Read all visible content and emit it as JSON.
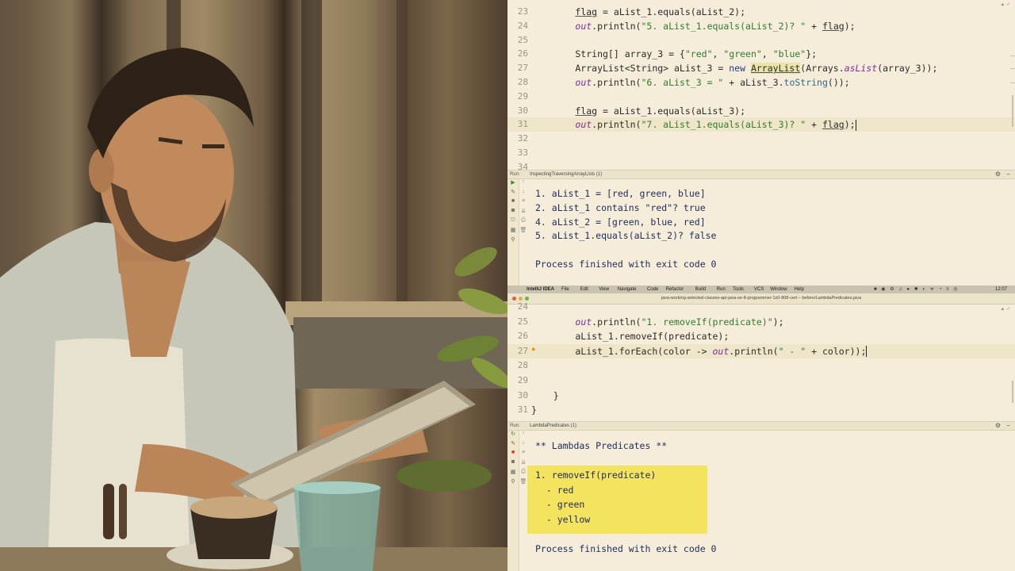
{
  "editor1": {
    "lines": [
      {
        "num": "23",
        "segments": [
          [
            "",
            "        "
          ],
          [
            "fld-u",
            "flag"
          ],
          [
            "",
            " = aList_1.equals(aList_2);"
          ]
        ]
      },
      {
        "num": "24",
        "segments": [
          [
            "",
            "        "
          ],
          [
            "fld",
            "out"
          ],
          [
            "",
            ".println("
          ],
          [
            "str",
            "\"5. aList_1.equals(aList_2)? \""
          ],
          [
            "",
            " + "
          ],
          [
            "u",
            "flag"
          ],
          [
            "",
            ");"
          ]
        ]
      },
      {
        "num": "25",
        "segments": []
      },
      {
        "num": "26",
        "segments": [
          [
            "",
            "        String[] array_3 = {"
          ],
          [
            "str",
            "\"red\""
          ],
          [
            "",
            ", "
          ],
          [
            "str",
            "\"green\""
          ],
          [
            "",
            ", "
          ],
          [
            "str",
            "\"blue\""
          ],
          [
            "",
            "};"
          ]
        ]
      },
      {
        "num": "27",
        "segments": [
          [
            "",
            "        ArrayList<String> aList_3 = "
          ],
          [
            "kw",
            "new "
          ],
          [
            "hl",
            "ArrayList"
          ],
          [
            "",
            "(Arrays."
          ],
          [
            "fld",
            "asList"
          ],
          [
            "",
            "(array_3));"
          ]
        ]
      },
      {
        "num": "28",
        "segments": [
          [
            "",
            "        "
          ],
          [
            "fld",
            "out"
          ],
          [
            "",
            ".println("
          ],
          [
            "str",
            "\"6. aList_3 = \""
          ],
          [
            "",
            " + aList_3."
          ],
          [
            "mth",
            "toString"
          ],
          [
            "",
            "());"
          ]
        ]
      },
      {
        "num": "29",
        "segments": []
      },
      {
        "num": "30",
        "segments": [
          [
            "",
            "        "
          ],
          [
            "u",
            "flag"
          ],
          [
            "",
            " = aList_1.equals(aList_3);"
          ]
        ]
      },
      {
        "num": "31",
        "segments": [
          [
            "",
            "        "
          ],
          [
            "fld",
            "out"
          ],
          [
            "",
            ".println("
          ],
          [
            "str",
            "\"7. aList_1.equals(aList_3)? \""
          ],
          [
            "",
            " + "
          ],
          [
            "u",
            "flag"
          ],
          [
            "",
            ");"
          ]
        ]
      },
      {
        "num": "32",
        "segments": []
      },
      {
        "num": "33",
        "segments": []
      },
      {
        "num": "34",
        "segments": []
      }
    ],
    "run_label": "Run:",
    "run_tab": "InspectingTraversingArrayLists (1)",
    "output": [
      "1. aList_1 = [red, green, blue]",
      "2. aList_1 contains \"red\"? true",
      "4. aList_2 = [green, blue, red]",
      "5. aList_1.equals(aList_2)? false",
      "",
      "Process finished with exit code 0"
    ]
  },
  "menubar": {
    "app": "IntelliJ IDEA",
    "items": [
      "File",
      "Edit",
      "View",
      "Navigate",
      "Code",
      "Refactor",
      "Build",
      "Run",
      "Tools",
      "VCS",
      "Window",
      "Help"
    ],
    "clock": "12:07"
  },
  "window_title": "java-working-selected-classes-api-java-se-8-programmer-1z0-808-cert – before/LambdaPredicates.java",
  "editor2": {
    "lines": [
      {
        "num": "24",
        "segments": []
      },
      {
        "num": "25",
        "segments": [
          [
            "",
            "        "
          ],
          [
            "fld",
            "out"
          ],
          [
            "",
            ".println("
          ],
          [
            "str",
            "\"1. removeIf(predicate)\""
          ],
          [
            "",
            ");"
          ]
        ]
      },
      {
        "num": "26",
        "segments": [
          [
            "",
            "        aList_1.removeIf(predicate);"
          ]
        ]
      },
      {
        "num": "27",
        "segments": [
          [
            "",
            "        aList_1.forEach(color -> "
          ],
          [
            "fld",
            "out"
          ],
          [
            "",
            ".println("
          ],
          [
            "str",
            "\" - \""
          ],
          [
            "",
            " + color));"
          ]
        ]
      },
      {
        "num": "28",
        "segments": []
      },
      {
        "num": "29",
        "segments": []
      },
      {
        "num": "30",
        "segments": [
          [
            "",
            "    }"
          ]
        ]
      },
      {
        "num": "31",
        "segments": [
          [
            "",
            "}"
          ]
        ]
      }
    ],
    "run_label": "Run:",
    "run_tab": "LambdaPredicates (1)",
    "output_header": "** Lambdas Predicates **",
    "output_highlight": [
      "1. removeIf(predicate)",
      "  - red",
      "  - green",
      "  - yellow"
    ],
    "output_footer": "Process finished with exit code 0"
  },
  "colors": {
    "editor_bg": "#f5edd9",
    "highlight_box": "#f4e35f",
    "string": "#2f7a2f",
    "keyword": "#1f3d8a",
    "field": "#7a2d9a"
  }
}
